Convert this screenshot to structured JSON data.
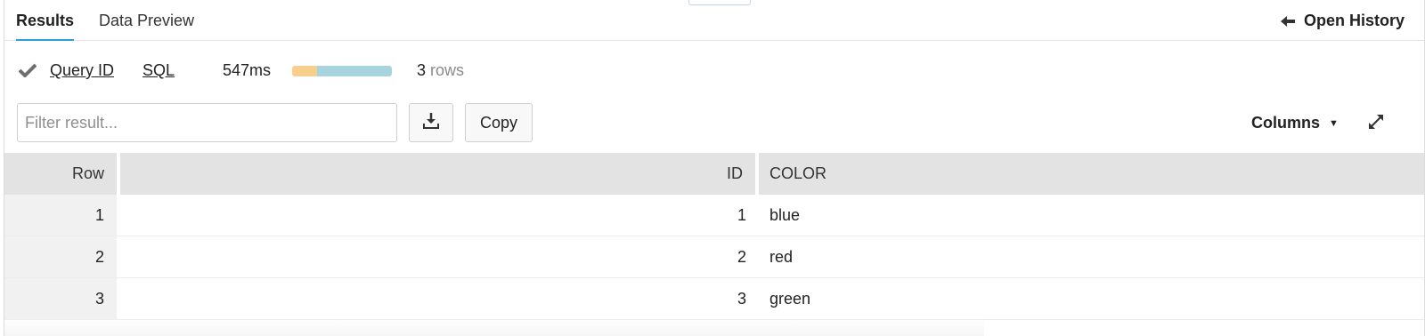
{
  "tabs": [
    {
      "label": "Results",
      "active": true
    },
    {
      "label": "Data Preview",
      "active": false
    }
  ],
  "open_history_label": "Open History",
  "status": {
    "query_id_label": "Query ID",
    "sql_label": "SQL",
    "duration": "547ms",
    "progress_fraction_segment1": 0.25,
    "rows_count": "3",
    "rows_label": "rows",
    "colors": {
      "segment1": "#f7cf8f",
      "segment2": "#a8d4de"
    }
  },
  "filter": {
    "placeholder": "Filter result...",
    "value": ""
  },
  "buttons": {
    "download_icon": "download-icon",
    "copy_label": "Copy",
    "columns_label": "Columns",
    "expand_icon": "expand-icon"
  },
  "table": {
    "headers": [
      "Row",
      "ID",
      "COLOR"
    ],
    "rows": [
      [
        "1",
        "1",
        "blue"
      ],
      [
        "2",
        "2",
        "red"
      ],
      [
        "3",
        "3",
        "green"
      ]
    ]
  },
  "accent": "#2aa0d8"
}
